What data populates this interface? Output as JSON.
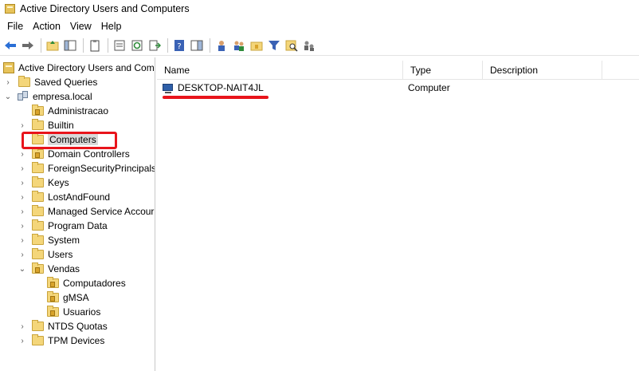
{
  "window": {
    "title": "Active Directory Users and Computers"
  },
  "menu": {
    "items": [
      "File",
      "Action",
      "View",
      "Help"
    ]
  },
  "toolbar": {
    "icons": [
      "back-arrow-icon",
      "forward-arrow-icon",
      "up-folder-icon",
      "show-tree-icon",
      "clipboard-icon",
      "properties-icon",
      "refresh-icon",
      "export-list-icon",
      "help-icon",
      "console-tree-icon",
      "new-user-icon",
      "new-group-icon",
      "new-ou-icon",
      "filter-icon",
      "find-icon",
      "delegate-icon"
    ]
  },
  "tree": {
    "root": "Active Directory Users and Com",
    "saved_queries": "Saved Queries",
    "domain": "empresa.local",
    "items": [
      {
        "label": "Administracao",
        "expand": "",
        "type": "ou"
      },
      {
        "label": "Builtin",
        "expand": "›",
        "type": "folder"
      },
      {
        "label": "Computers",
        "expand": "",
        "type": "folder"
      },
      {
        "label": "Domain Controllers",
        "expand": "›",
        "type": "ou"
      },
      {
        "label": "ForeignSecurityPrincipals",
        "expand": "›",
        "type": "folder"
      },
      {
        "label": "Keys",
        "expand": "›",
        "type": "folder"
      },
      {
        "label": "LostAndFound",
        "expand": "›",
        "type": "folder"
      },
      {
        "label": "Managed Service Accour",
        "expand": "›",
        "type": "folder"
      },
      {
        "label": "Program Data",
        "expand": "›",
        "type": "folder"
      },
      {
        "label": "System",
        "expand": "›",
        "type": "folder"
      },
      {
        "label": "Users",
        "expand": "›",
        "type": "folder"
      },
      {
        "label": "Vendas",
        "expand": "⌄",
        "type": "ou"
      },
      {
        "label": "NTDS Quotas",
        "expand": "›",
        "type": "folder"
      },
      {
        "label": "TPM Devices",
        "expand": "›",
        "type": "folder"
      }
    ],
    "vendas_children": [
      "Computadores",
      "gMSA",
      "Usuarios"
    ]
  },
  "list": {
    "columns": [
      "Name",
      "Type",
      "Description"
    ],
    "rows": [
      {
        "name": "DESKTOP-NAIT4JL",
        "type": "Computer",
        "description": ""
      }
    ]
  },
  "colors": {
    "highlight": "#e8141b",
    "folder": "#f4d67a"
  }
}
